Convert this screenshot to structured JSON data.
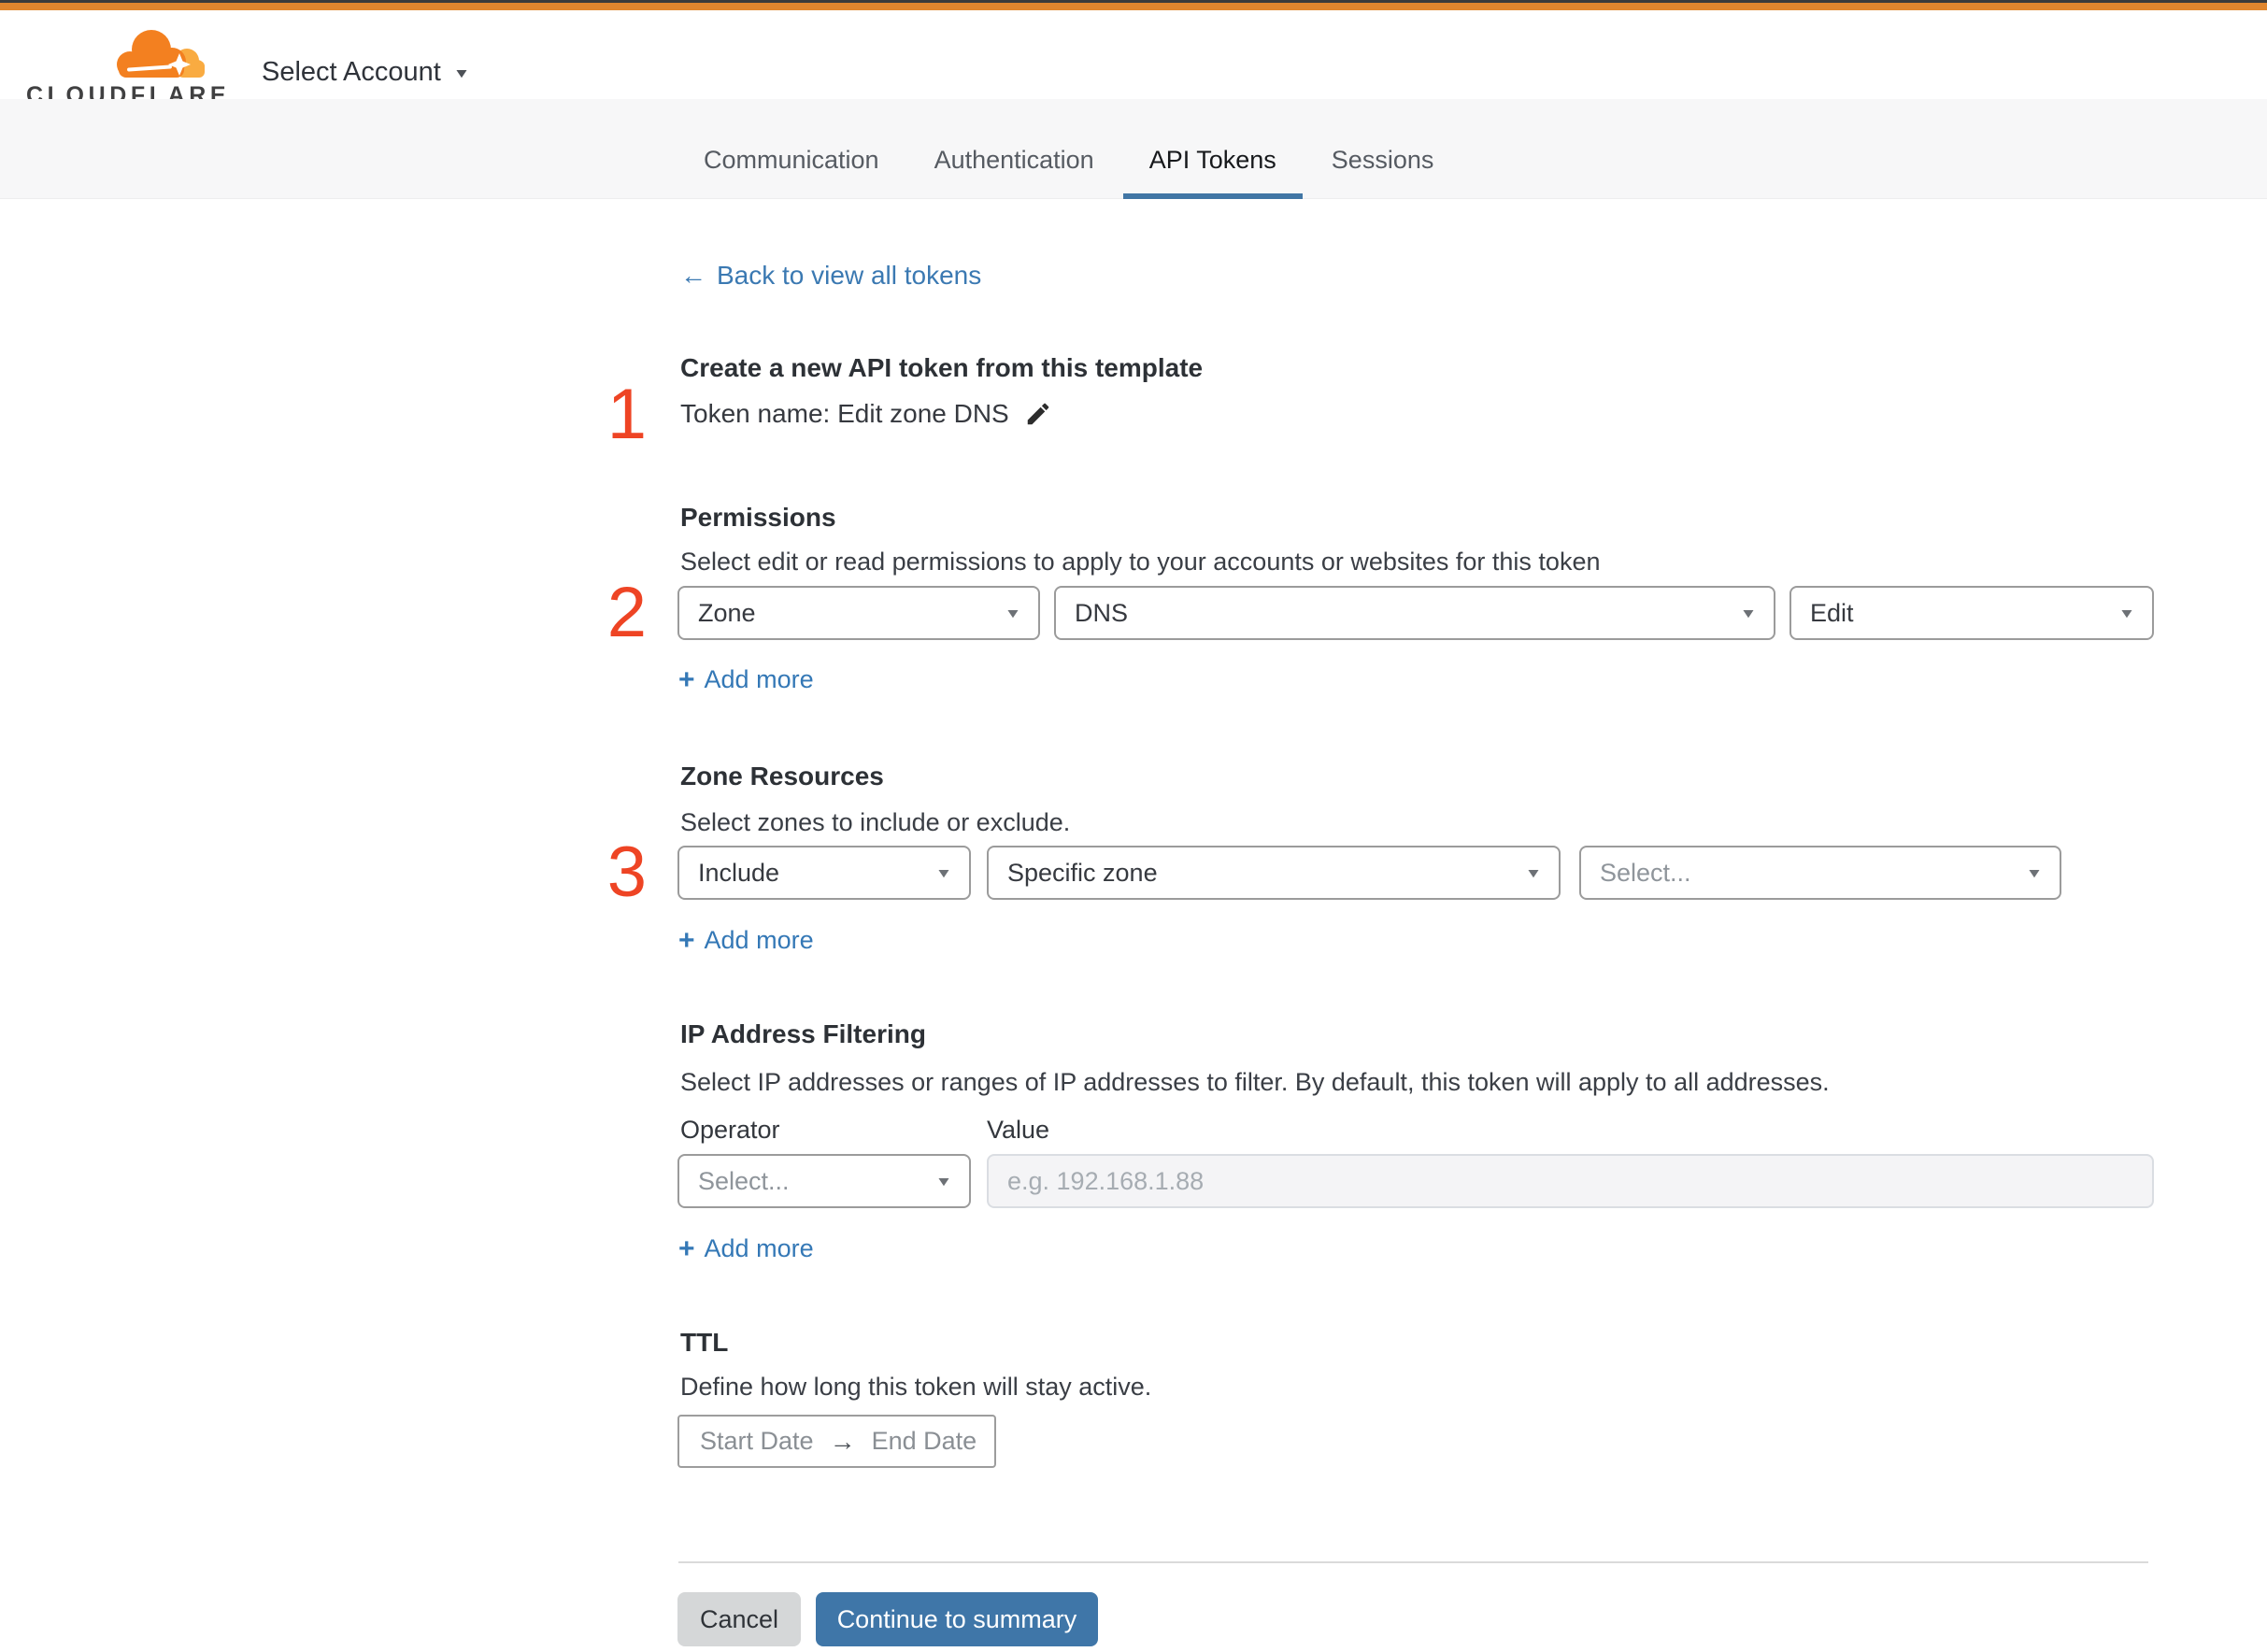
{
  "icons": {
    "caret_down": "▼",
    "back_arrow": "←",
    "plus": "+",
    "range_arrow": "→"
  },
  "header": {
    "logo_text": "CLOUDFLARE",
    "account_selector_label": "Select Account"
  },
  "tabs": {
    "items": [
      {
        "label": "Communication"
      },
      {
        "label": "Authentication"
      },
      {
        "label": "API Tokens"
      },
      {
        "label": "Sessions"
      }
    ],
    "active": "API Tokens"
  },
  "back_link": {
    "label": "Back to view all tokens"
  },
  "template_section": {
    "step_number": "1",
    "title": "Create a new API token from this template",
    "token_name_line": "Token name: Edit zone DNS"
  },
  "permissions_section": {
    "step_number": "2",
    "title": "Permissions",
    "subtitle": "Select edit or read permissions to apply to your accounts or websites for this token",
    "scope_dropdown_value": "Zone",
    "permission_dropdown_value": "DNS",
    "access_dropdown_value": "Edit",
    "add_more_label": "Add more"
  },
  "zone_resources_section": {
    "step_number": "3",
    "title": "Zone Resources",
    "subtitle": "Select zones to include or exclude.",
    "include_dropdown_value": "Include",
    "type_dropdown_value": "Specific zone",
    "zone_dropdown_placeholder": "Select...",
    "add_more_label": "Add more"
  },
  "ip_filtering_section": {
    "title": "IP Address Filtering",
    "subtitle": "Select IP addresses or ranges of IP addresses to filter. By default, this token will apply to all addresses.",
    "operator_label": "Operator",
    "value_label": "Value",
    "operator_dropdown_placeholder": "Select...",
    "value_input_placeholder": "e.g. 192.168.1.88",
    "add_more_label": "Add more"
  },
  "ttl_section": {
    "title": "TTL",
    "subtitle": "Define how long this token will stay active.",
    "start_date_placeholder": "Start Date",
    "end_date_placeholder": "End Date"
  },
  "footer": {
    "cancel_label": "Cancel",
    "continue_label": "Continue to summary"
  },
  "colors": {
    "brand_orange": "#f38020",
    "brand_orange_light": "#f9ab41",
    "top_bar_orange": "#e0862e",
    "primary_button_blue": "#3f76a8",
    "link_blue": "#3b79b2",
    "step_number_red": "#ee4424",
    "active_tab_underline": "#4176a5",
    "tab_bar_background": "#f7f7f8"
  }
}
